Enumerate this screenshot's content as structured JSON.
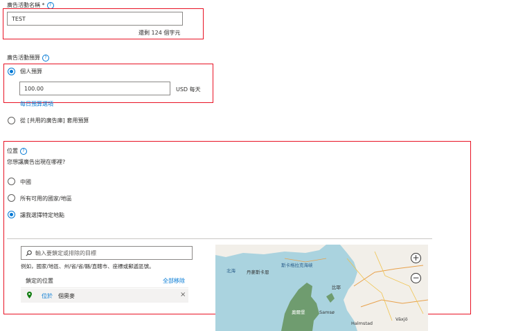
{
  "campaign_name": {
    "label": "廣告活動名稱 *",
    "value": "TEST",
    "remaining": "還剩 124 個字元"
  },
  "budget": {
    "label": "廣告活動預算",
    "individual_label": "個人預算",
    "amount": "100.00",
    "unit": "USD 每天",
    "daily_link": "每日預算選項",
    "shared_label": "從 [共用的廣告庫] 套用預算"
  },
  "location": {
    "label": "位置",
    "question": "您想讓廣告出現在哪裡?",
    "options": [
      "中國",
      "所有可用的國家/地區",
      "讓我選擇特定地點"
    ],
    "search_placeholder": "輸入要鎖定或排除的目標",
    "example": "例如，國家/地區、州/省/省/縣/直轄市、座標或郵遞區號。",
    "targeted_label": "鎖定的位置",
    "remove_all": "全部移除",
    "item_status": "位於",
    "item_name": "個奧麥"
  },
  "map": {
    "labels": [
      "北海",
      "丹麥斯卡恩",
      "斯卡格拉克海峽",
      "比耶",
      "奧爾堡",
      "Samsø",
      "Halmstad",
      "Växjö"
    ],
    "zoom_in": "+",
    "zoom_out": "−"
  }
}
